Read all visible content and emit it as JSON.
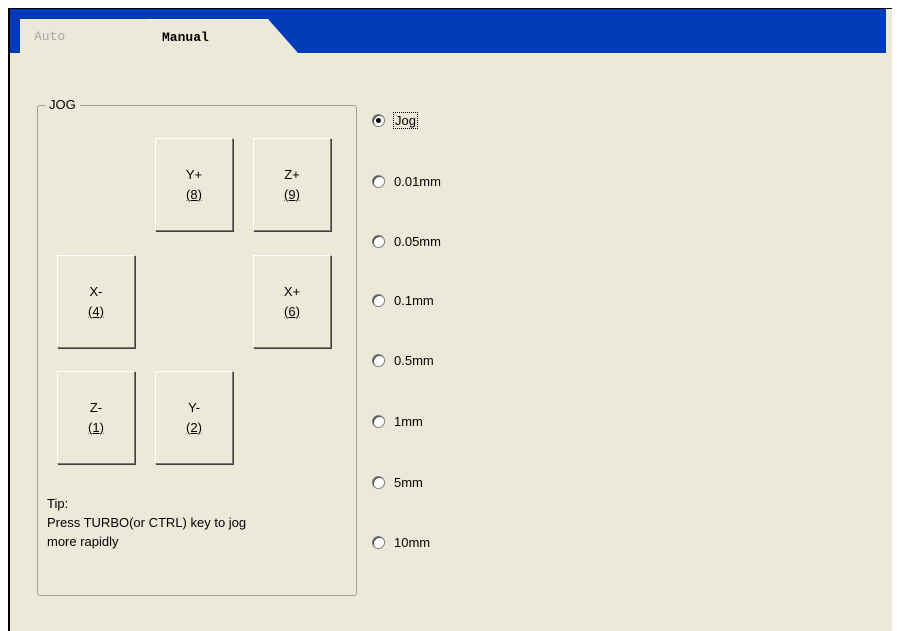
{
  "tabs": [
    {
      "label": "Auto",
      "active": false
    },
    {
      "label": "Manual",
      "active": true
    }
  ],
  "jog_group": {
    "title": "JOG",
    "buttons": {
      "y_plus": {
        "axis": "Y+",
        "key": "(8)"
      },
      "z_plus": {
        "axis": "Z+",
        "key": "(9)"
      },
      "x_minus": {
        "axis": "X-",
        "key": "(4)"
      },
      "x_plus": {
        "axis": "X+",
        "key": "(6)"
      },
      "z_minus": {
        "axis": "Z-",
        "key": "(1)"
      },
      "y_minus": {
        "axis": "Y-",
        "key": "(2)"
      }
    },
    "tip_title": "Tip:",
    "tip_line1": "Press TURBO(or CTRL) key to jog",
    "tip_line2": "more rapidly"
  },
  "step_options": [
    {
      "label": "Jog",
      "checked": true
    },
    {
      "label": "0.01mm",
      "checked": false
    },
    {
      "label": "0.05mm",
      "checked": false
    },
    {
      "label": "0.1mm",
      "checked": false
    },
    {
      "label": "0.5mm",
      "checked": false
    },
    {
      "label": "1mm",
      "checked": false
    },
    {
      "label": "5mm",
      "checked": false
    },
    {
      "label": "10mm",
      "checked": false
    }
  ],
  "colors": {
    "panel_bg": "#ece9d8",
    "tab_strip": "#003cb8"
  }
}
